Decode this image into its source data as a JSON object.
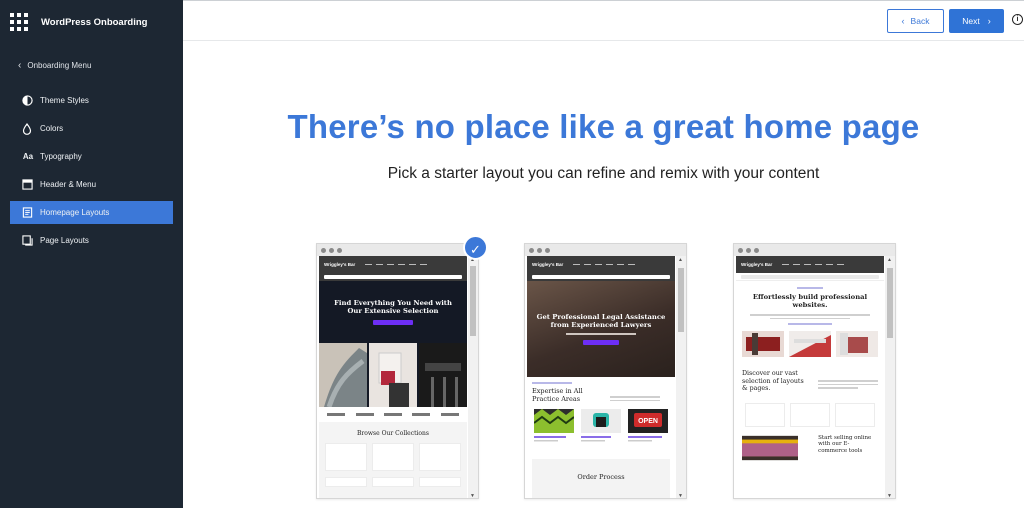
{
  "sidebar": {
    "title": "WordPress Onboarding",
    "back_label": "Onboarding Menu",
    "items": [
      {
        "label": "Theme Styles",
        "icon": "half-circle-icon"
      },
      {
        "label": "Colors",
        "icon": "droplet-icon"
      },
      {
        "label": "Typography",
        "icon": "typography-icon"
      },
      {
        "label": "Header & Menu",
        "icon": "layout-header-icon"
      },
      {
        "label": "Homepage Layouts",
        "icon": "document-icon",
        "active": true
      },
      {
        "label": "Page Layouts",
        "icon": "pages-icon"
      }
    ]
  },
  "toolbar": {
    "back_label": "Back",
    "next_label": "Next",
    "info_label": "i"
  },
  "main": {
    "headline": "There’s no place like a great home page",
    "subline": "Pick a starter layout you can refine and remix with your content"
  },
  "layouts": [
    {
      "brand": "Wriggley's Bar",
      "hero_title": "Find Everything You Need with Our Extensive Selection",
      "section_title": "Browse Our Collections",
      "selected": true
    },
    {
      "brand": "Wriggley's Bar",
      "hero_title": "Get Professional Legal Assistance from Experienced Lawyers",
      "section_title": "Expertise in All Practice Areas",
      "section_title_2": "Order Process",
      "badge_text": "OPEN"
    },
    {
      "brand": "Wriggley's Bar",
      "hero_title": "Effortlessly build professional websites.",
      "section_title": "Discover our vast selection of layouts & pages.",
      "section_title_2": "Start selling online with our E-commerce tools"
    }
  ],
  "colors": {
    "accent": "#3c78d8",
    "sidebar_bg": "#1d2733",
    "active_item": "#3c78d8"
  }
}
